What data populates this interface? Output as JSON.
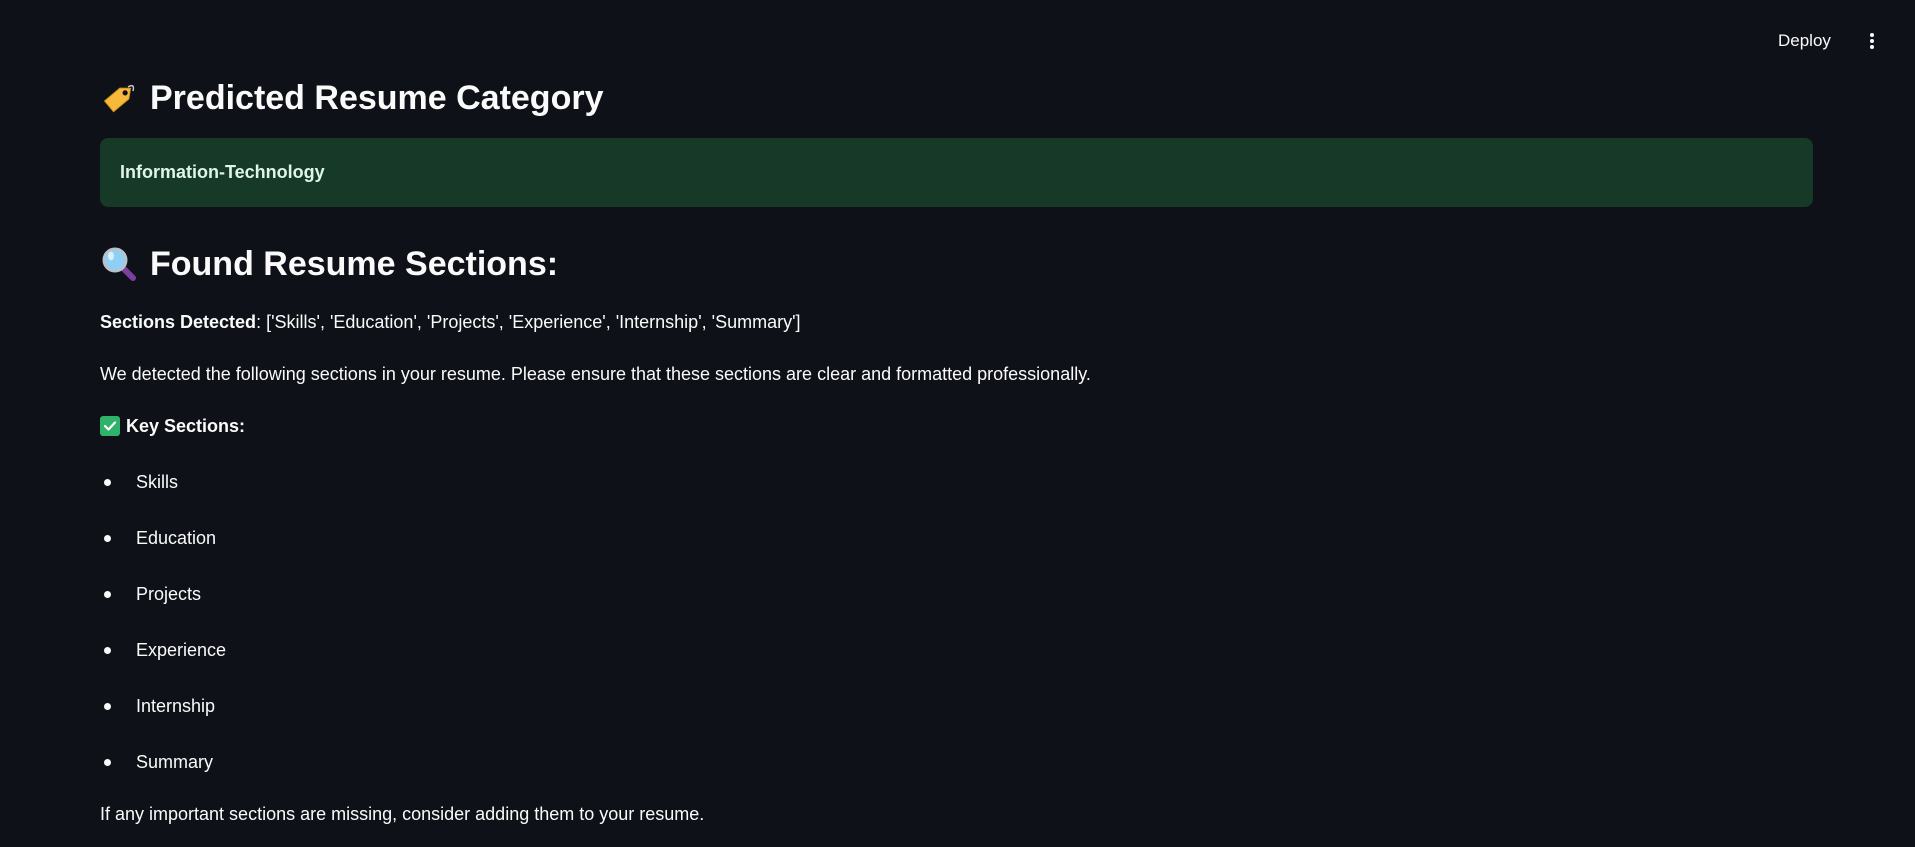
{
  "toolbar": {
    "deploy_label": "Deploy",
    "menu_icon": "kebab-vertical-icon"
  },
  "category": {
    "icon": "label-tag-icon",
    "heading": "Predicted Resume Category",
    "value": "Information-Technology",
    "box_color": "#173928"
  },
  "sections": {
    "icon": "magnifier-icon",
    "heading": "Found Resume Sections:",
    "detected_label": "Sections Detected",
    "detected_value": ": ['Skills', 'Education', 'Projects', 'Experience', 'Internship', 'Summary']",
    "info_text": "We detected the following sections in your resume. Please ensure that these sections are clear and formatted professionally.",
    "key_icon": "check-mark-icon",
    "key_label": "Key Sections:",
    "items": [
      "Skills",
      "Education",
      "Projects",
      "Experience",
      "Internship",
      "Summary"
    ],
    "footer_text": "If any important sections are missing, consider adding them to your resume."
  },
  "colors": {
    "background": "#0e1117",
    "text": "#fafafa",
    "success_box": "#173928",
    "check": "#2fb36a"
  }
}
